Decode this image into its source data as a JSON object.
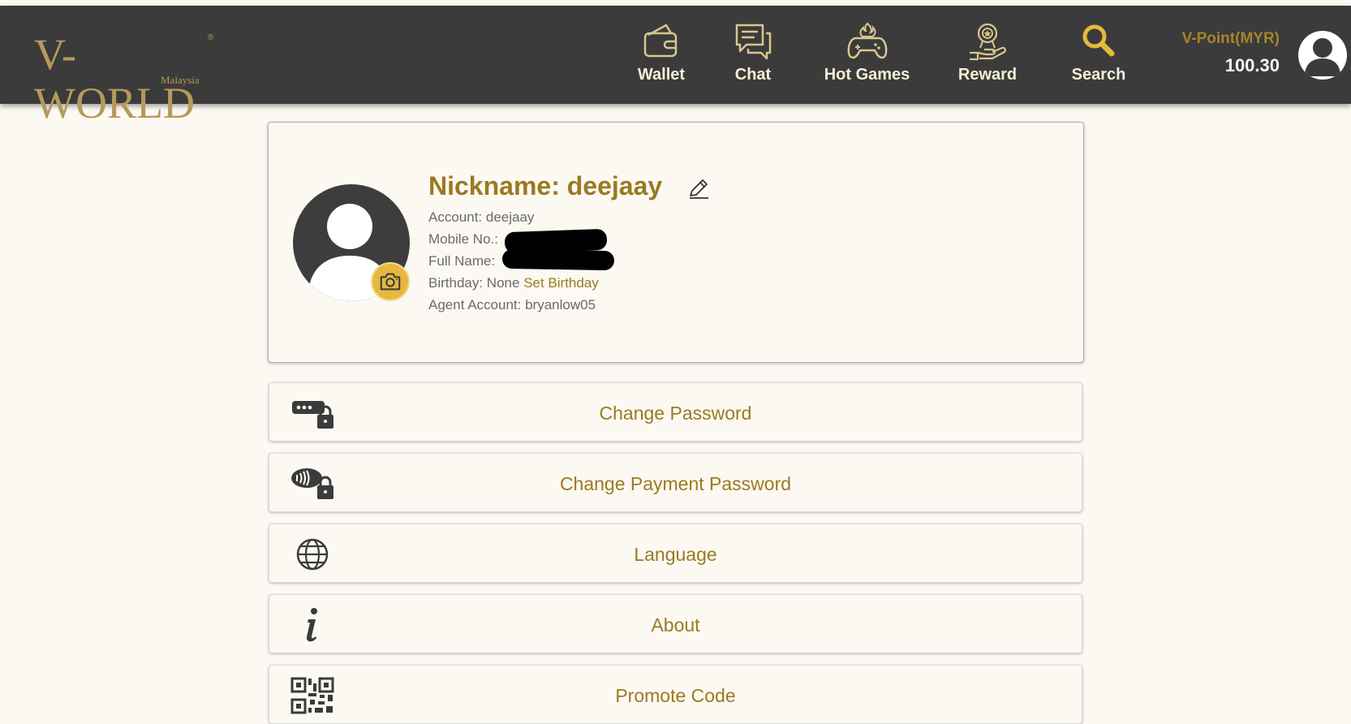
{
  "header": {
    "logo": {
      "brand": "V-WORLD",
      "registered": "®",
      "region": "Malaysia"
    },
    "nav": [
      {
        "label": "Wallet",
        "icon": "wallet-icon"
      },
      {
        "label": "Chat",
        "icon": "chat-icon"
      },
      {
        "label": "Hot Games",
        "icon": "gamepad-icon"
      },
      {
        "label": "Reward",
        "icon": "reward-icon"
      },
      {
        "label": "Search",
        "icon": "search-icon"
      }
    ],
    "vpoint": {
      "label": "V-Point(MYR)",
      "value": "100.30"
    }
  },
  "profile": {
    "nickname": "Nickname: deejaay",
    "account": "Account: deejaay",
    "mobile_label": "Mobile No.:",
    "fullname_label": "Full Name:",
    "birthday_label": "Birthday: None",
    "birthday_link": "Set Birthday",
    "agent": "Agent Account: bryanlow05"
  },
  "menu": [
    {
      "label": "Change Password",
      "icon": "password-lock-icon"
    },
    {
      "label": "Change Payment Password",
      "icon": "payment-lock-icon"
    },
    {
      "label": "Language",
      "icon": "globe-icon"
    },
    {
      "label": "About",
      "icon": "info-icon"
    },
    {
      "label": "Promote Code",
      "icon": "qr-code-icon"
    }
  ],
  "colors": {
    "header_bg": "#3b3b3b",
    "gold": "#9a7a22",
    "page_bg": "#fcf9f3",
    "camera_badge": "#e7b83f"
  }
}
